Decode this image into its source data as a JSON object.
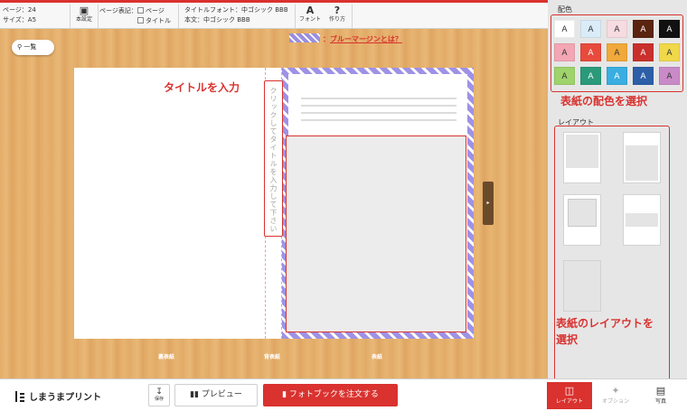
{
  "toolbar": {
    "pages": "ページ：24",
    "size": "サイズ：A5",
    "book_settings": "本設定",
    "page_notation_label": "ページ表記：",
    "check_page": "ページ",
    "check_title": "タイトル",
    "title_font": "タイトルフォント：中ゴシック BBB",
    "body_font": "本文：中ゴシック BBB",
    "font_button": "フォント",
    "help_button": "作り方"
  },
  "canvas": {
    "zoom_button": "一覧",
    "bleed_link": "ブルーマージンとは？",
    "bleed_colon": "：",
    "spine_placeholder": "クリックしてタイトルを入力して下さい",
    "title_callout": "タイトルを入力",
    "label_back": "裏表紙",
    "label_spine": "背表紙",
    "label_front": "表紙",
    "colors": {
      "accent": "#d9322f",
      "bleed": "#9e92e6"
    }
  },
  "panel": {
    "color_heading": "配色",
    "layout_heading": "レイアウト",
    "color_note": "表紙の配色を選択",
    "layout_note_line1": "表紙のレイアウトを",
    "layout_note_line2": "選択",
    "swatches": [
      {
        "label": "A",
        "bg": "#ffffff",
        "fg": "#333333"
      },
      {
        "label": "A",
        "bg": "#d9ecf7",
        "fg": "#333333"
      },
      {
        "label": "A",
        "bg": "#f6dbe0",
        "fg": "#333333"
      },
      {
        "label": "A",
        "bg": "#5a2410",
        "fg": "#ffffff"
      },
      {
        "label": "A",
        "bg": "#111111",
        "fg": "#ffffff"
      },
      {
        "label": "A",
        "bg": "#f4a6b4",
        "fg": "#333333"
      },
      {
        "label": "A",
        "bg": "#e84a3c",
        "fg": "#ffffff"
      },
      {
        "label": "A",
        "bg": "#f0a93a",
        "fg": "#333333"
      },
      {
        "label": "A",
        "bg": "#c9302c",
        "fg": "#ffffff"
      },
      {
        "label": "A",
        "bg": "#f1d84a",
        "fg": "#333333"
      },
      {
        "label": "A",
        "bg": "#9fd36c",
        "fg": "#333333"
      },
      {
        "label": "A",
        "bg": "#2a9a7a",
        "fg": "#ffffff"
      },
      {
        "label": "A",
        "bg": "#3aaee0",
        "fg": "#ffffff"
      },
      {
        "label": "A",
        "bg": "#2d5fa8",
        "fg": "#ffffff"
      },
      {
        "label": "A",
        "bg": "#c98bc7",
        "fg": "#333333"
      }
    ]
  },
  "bottom": {
    "logo": "しまうまプリント",
    "save": "保存",
    "preview": "プレビュー",
    "order": "フォトブックを注文する",
    "tab_layout": "レイアウト",
    "tab_option": "オプション",
    "tab_photo": "写真"
  }
}
